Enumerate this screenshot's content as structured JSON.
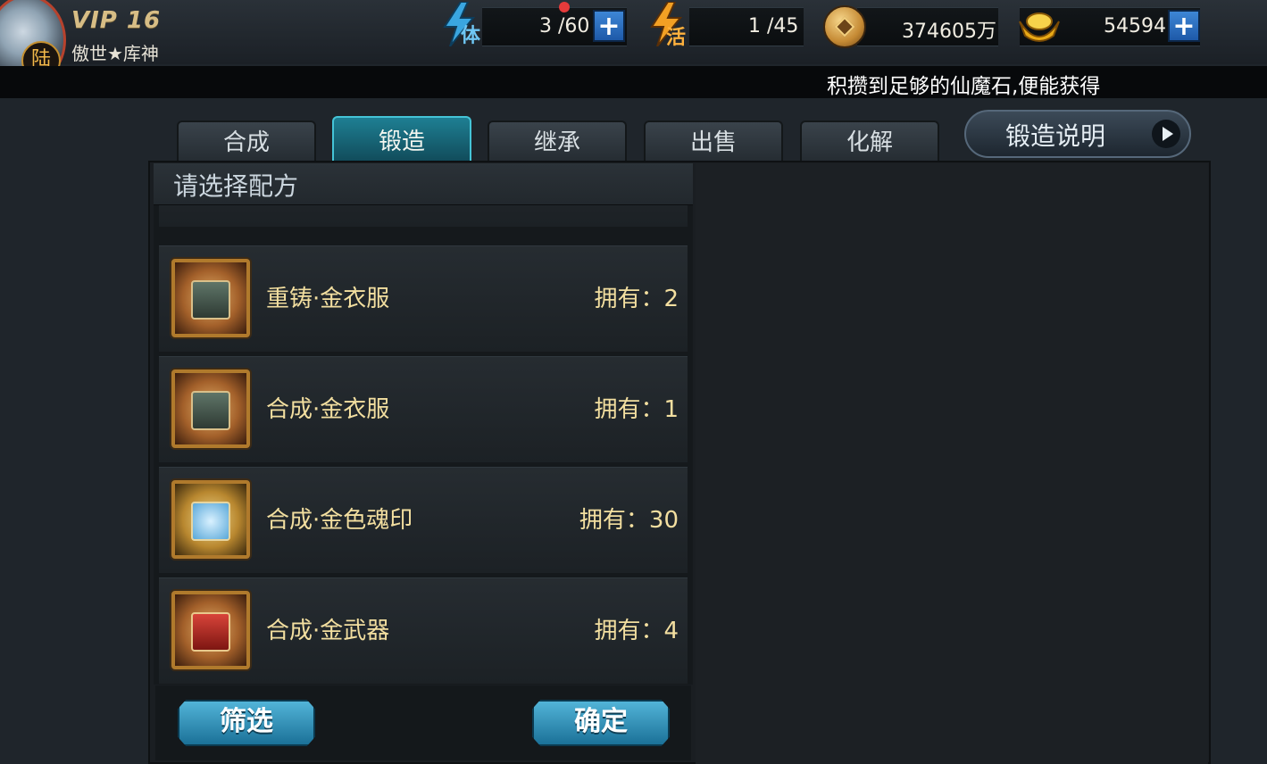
{
  "player": {
    "vip": "VIP 16",
    "name": "傲世★库神",
    "badge": "陆"
  },
  "resources": {
    "stamina": {
      "icon_label": "体",
      "value": "3 /60"
    },
    "activity": {
      "icon_label": "活",
      "value": "1 /45"
    },
    "coins": {
      "value": "374605万"
    },
    "gold": {
      "value": "54594"
    }
  },
  "marquee": "积攒到足够的仙魔石,便能获得",
  "tabs": [
    {
      "label": "合成"
    },
    {
      "label": "锻造"
    },
    {
      "label": "继承"
    },
    {
      "label": "出售"
    },
    {
      "label": "化解"
    }
  ],
  "help_button": "锻造说明",
  "list": {
    "header": "请选择配方",
    "items": [
      {
        "name": "重铸·金衣服",
        "owned": "拥有：2",
        "icon": "clothing-scroll-icon"
      },
      {
        "name": "合成·金衣服",
        "owned": "拥有：1",
        "icon": "clothing-scroll-icon"
      },
      {
        "name": "合成·金色魂印",
        "owned": "拥有：30",
        "icon": "soul-seal-scroll-icon"
      },
      {
        "name": "合成·金武器",
        "owned": "拥有：4",
        "icon": "weapon-scroll-icon"
      }
    ]
  },
  "buttons": {
    "filter": "筛选",
    "confirm": "确定"
  },
  "colors": {
    "active_tab": "#1e7f93",
    "item_text": "#f3dfa0",
    "button_blue": "#3a9cc6"
  }
}
